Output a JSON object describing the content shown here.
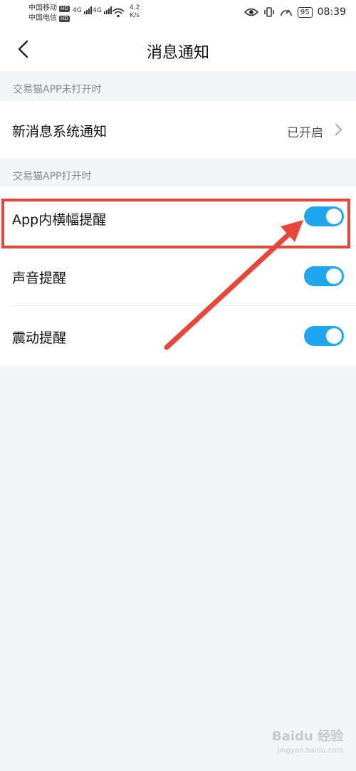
{
  "status": {
    "carrier1": "中国移动",
    "carrier2": "中国电信",
    "hd": "HD",
    "net": "4G",
    "speed_value": "4.2",
    "speed_unit": "K/s",
    "battery": "95",
    "time": "08:39"
  },
  "nav": {
    "title": "消息通知"
  },
  "section1": {
    "label": "交易猫APP未打开时",
    "item_label": "新消息系统通知",
    "item_value": "已开启"
  },
  "section2": {
    "label": "交易猫APP打开时",
    "items": [
      {
        "label": "App内横幅提醒",
        "on": true
      },
      {
        "label": "声音提醒",
        "on": true
      },
      {
        "label": "震动提醒",
        "on": true
      }
    ]
  },
  "colors": {
    "toggle_on": "#1ea7f0",
    "annotation": "#e8463a"
  },
  "watermark": {
    "brand": "Baidu 经验",
    "url": "jingyan.baidu.com"
  }
}
